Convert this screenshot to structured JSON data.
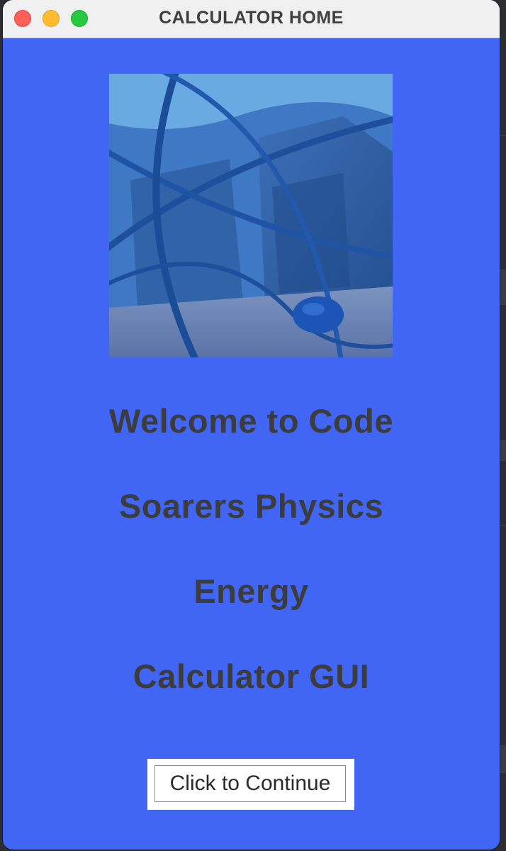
{
  "window": {
    "title": "CALCULATOR HOME",
    "background_color": "#4066f3"
  },
  "hero_image": {
    "description_icon": "blue-atom-sculpture-image"
  },
  "welcome_lines": [
    "Welcome to Code",
    "Soarers Physics",
    "Energy",
    "Calculator GUI"
  ],
  "continue_button": {
    "label": "Click to Continue"
  },
  "colors": {
    "close": "#fe5f57",
    "minimize": "#febc2e",
    "maximize": "#28c840",
    "text": "#3c3c3c"
  }
}
